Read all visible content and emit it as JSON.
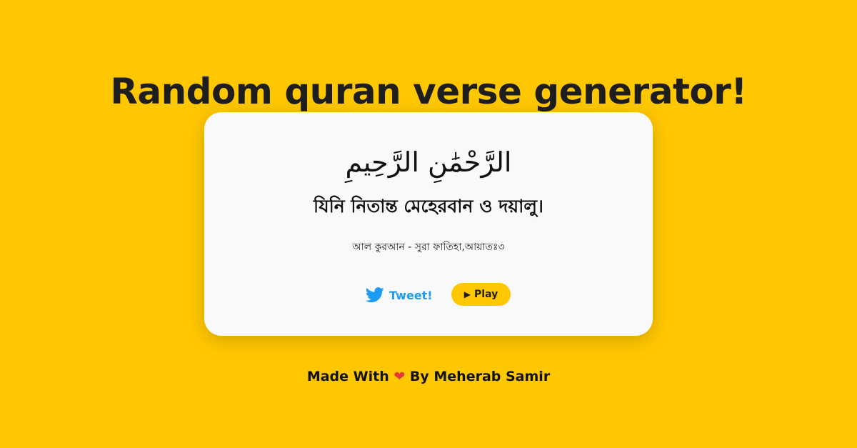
{
  "header": {
    "title": "Random quran verse generator!"
  },
  "card": {
    "arabic_text": "الرَّحْمَٰنِ الرَّحِيمِ",
    "translation": "যিনি নিতান্ত মেহেরবান ও দয়ালু।",
    "reference": "আল কুরআন - সুরা ফাতিহা,আয়াতঃ৩",
    "tweet_label": "Tweet!",
    "play_label": "Play"
  },
  "footer": {
    "prefix": "Made With",
    "heart": "❤",
    "suffix": "By Meherab Samir"
  },
  "colors": {
    "background": "#FFC700",
    "card": "#f9f9fa",
    "tweet": "#1d9bf0"
  },
  "icons": {
    "tweet": "twitter-bird-icon",
    "play": "play-icon",
    "heart": "heart-icon"
  }
}
